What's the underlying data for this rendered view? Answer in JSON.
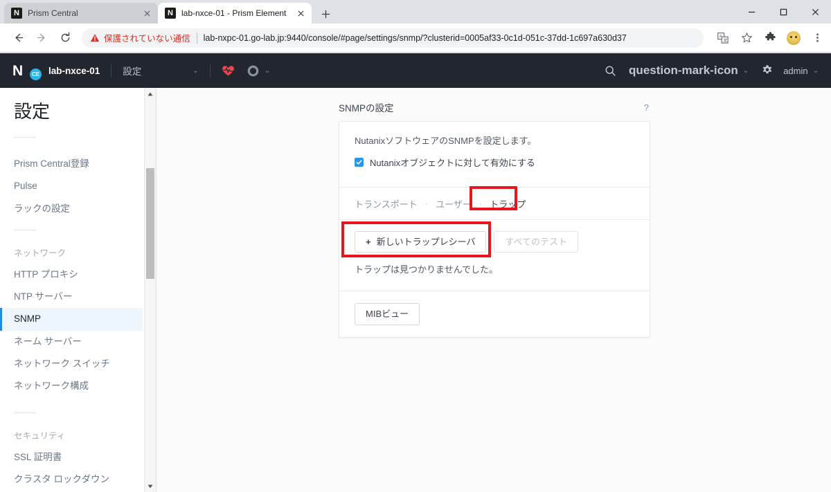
{
  "browser": {
    "tabs": [
      {
        "title": "Prism Central",
        "favicon": "nutanix-favicon",
        "active": false
      },
      {
        "title": "lab-nxce-01 - Prism Element",
        "favicon": "nutanix-favicon",
        "active": true
      }
    ],
    "new_tab_label": "+",
    "close_label": "✕",
    "window_controls": {
      "minimize": "minimize-icon",
      "maximize": "maximize-icon",
      "close": "close-icon"
    },
    "toolbar": {
      "back": "back-arrow-icon",
      "forward": "forward-arrow-icon",
      "reload": "reload-icon",
      "security_warning": "保護されていない通信",
      "url": "lab-nxpc-01.go-lab.jp:9440/console/#page/settings/snmp/?clusterid=0005af33-0c1d-051c-37dd-1c697a630d37",
      "translate": "translate-icon",
      "bookmark": "star-icon",
      "extensions": "puzzle-icon",
      "profile": "avatar-icon",
      "menu": "three-dot-menu-icon"
    }
  },
  "prism_nav": {
    "logo_mark": "N",
    "logo_badge": "CE",
    "cluster_name": "lab-nxce-01",
    "section": "設定",
    "section_caret": "⌄",
    "health_icon": "heart-pulse-icon",
    "status_icon": "ring-icon",
    "status_caret": "⌄",
    "search_icon": "search-icon",
    "help_icon": "question-mark-icon",
    "help_caret": "⌄",
    "settings_icon": "gear-icon",
    "user": "admin",
    "user_caret": "⌄"
  },
  "sidebar": {
    "title": "設定",
    "items": [
      {
        "label": "Prism Central登録",
        "active": false,
        "type": "item"
      },
      {
        "label": "Pulse",
        "active": false,
        "type": "item"
      },
      {
        "label": "ラックの設定",
        "active": false,
        "type": "item"
      },
      {
        "label": "ネットワーク",
        "active": false,
        "type": "group"
      },
      {
        "label": "HTTP プロキシ",
        "active": false,
        "type": "item"
      },
      {
        "label": "NTP サーバー",
        "active": false,
        "type": "item"
      },
      {
        "label": "SNMP",
        "active": true,
        "type": "item"
      },
      {
        "label": "ネーム サーバー",
        "active": false,
        "type": "item"
      },
      {
        "label": "ネットワーク スイッチ",
        "active": false,
        "type": "item"
      },
      {
        "label": "ネットワーク構成",
        "active": false,
        "type": "item"
      },
      {
        "label": "セキュリティ",
        "active": false,
        "type": "group"
      },
      {
        "label": "SSL 証明書",
        "active": false,
        "type": "item"
      },
      {
        "label": "クラスタ ロックダウン",
        "active": false,
        "type": "item"
      }
    ],
    "scroll_up_arrow": "▲",
    "scroll_down_arrow": "▼"
  },
  "main": {
    "panel_title": "SNMPの設定",
    "panel_help": "?",
    "description": "NutanixソフトウェアのSNMPを設定します。",
    "checkbox_label": "Nutanixオブジェクトに対して有効にする",
    "checkbox_checked": true,
    "tabs": [
      {
        "label": "トランスポート",
        "active": false
      },
      {
        "label": "ユーザー",
        "active": false
      },
      {
        "label": "トラップ",
        "active": true
      }
    ],
    "tab_separator": "·",
    "new_trap_button": "新しいトラップレシーバ",
    "new_trap_plus": "+",
    "test_all_button": "すべてのテスト",
    "test_all_disabled": true,
    "empty_message": "トラップは見つかりませんでした。",
    "mib_button": "MIBビュー"
  },
  "annotations": {
    "color": "#e8161b",
    "boxes": [
      {
        "name": "trap-tab-highlight"
      },
      {
        "name": "new-trap-receiver-highlight"
      }
    ]
  }
}
